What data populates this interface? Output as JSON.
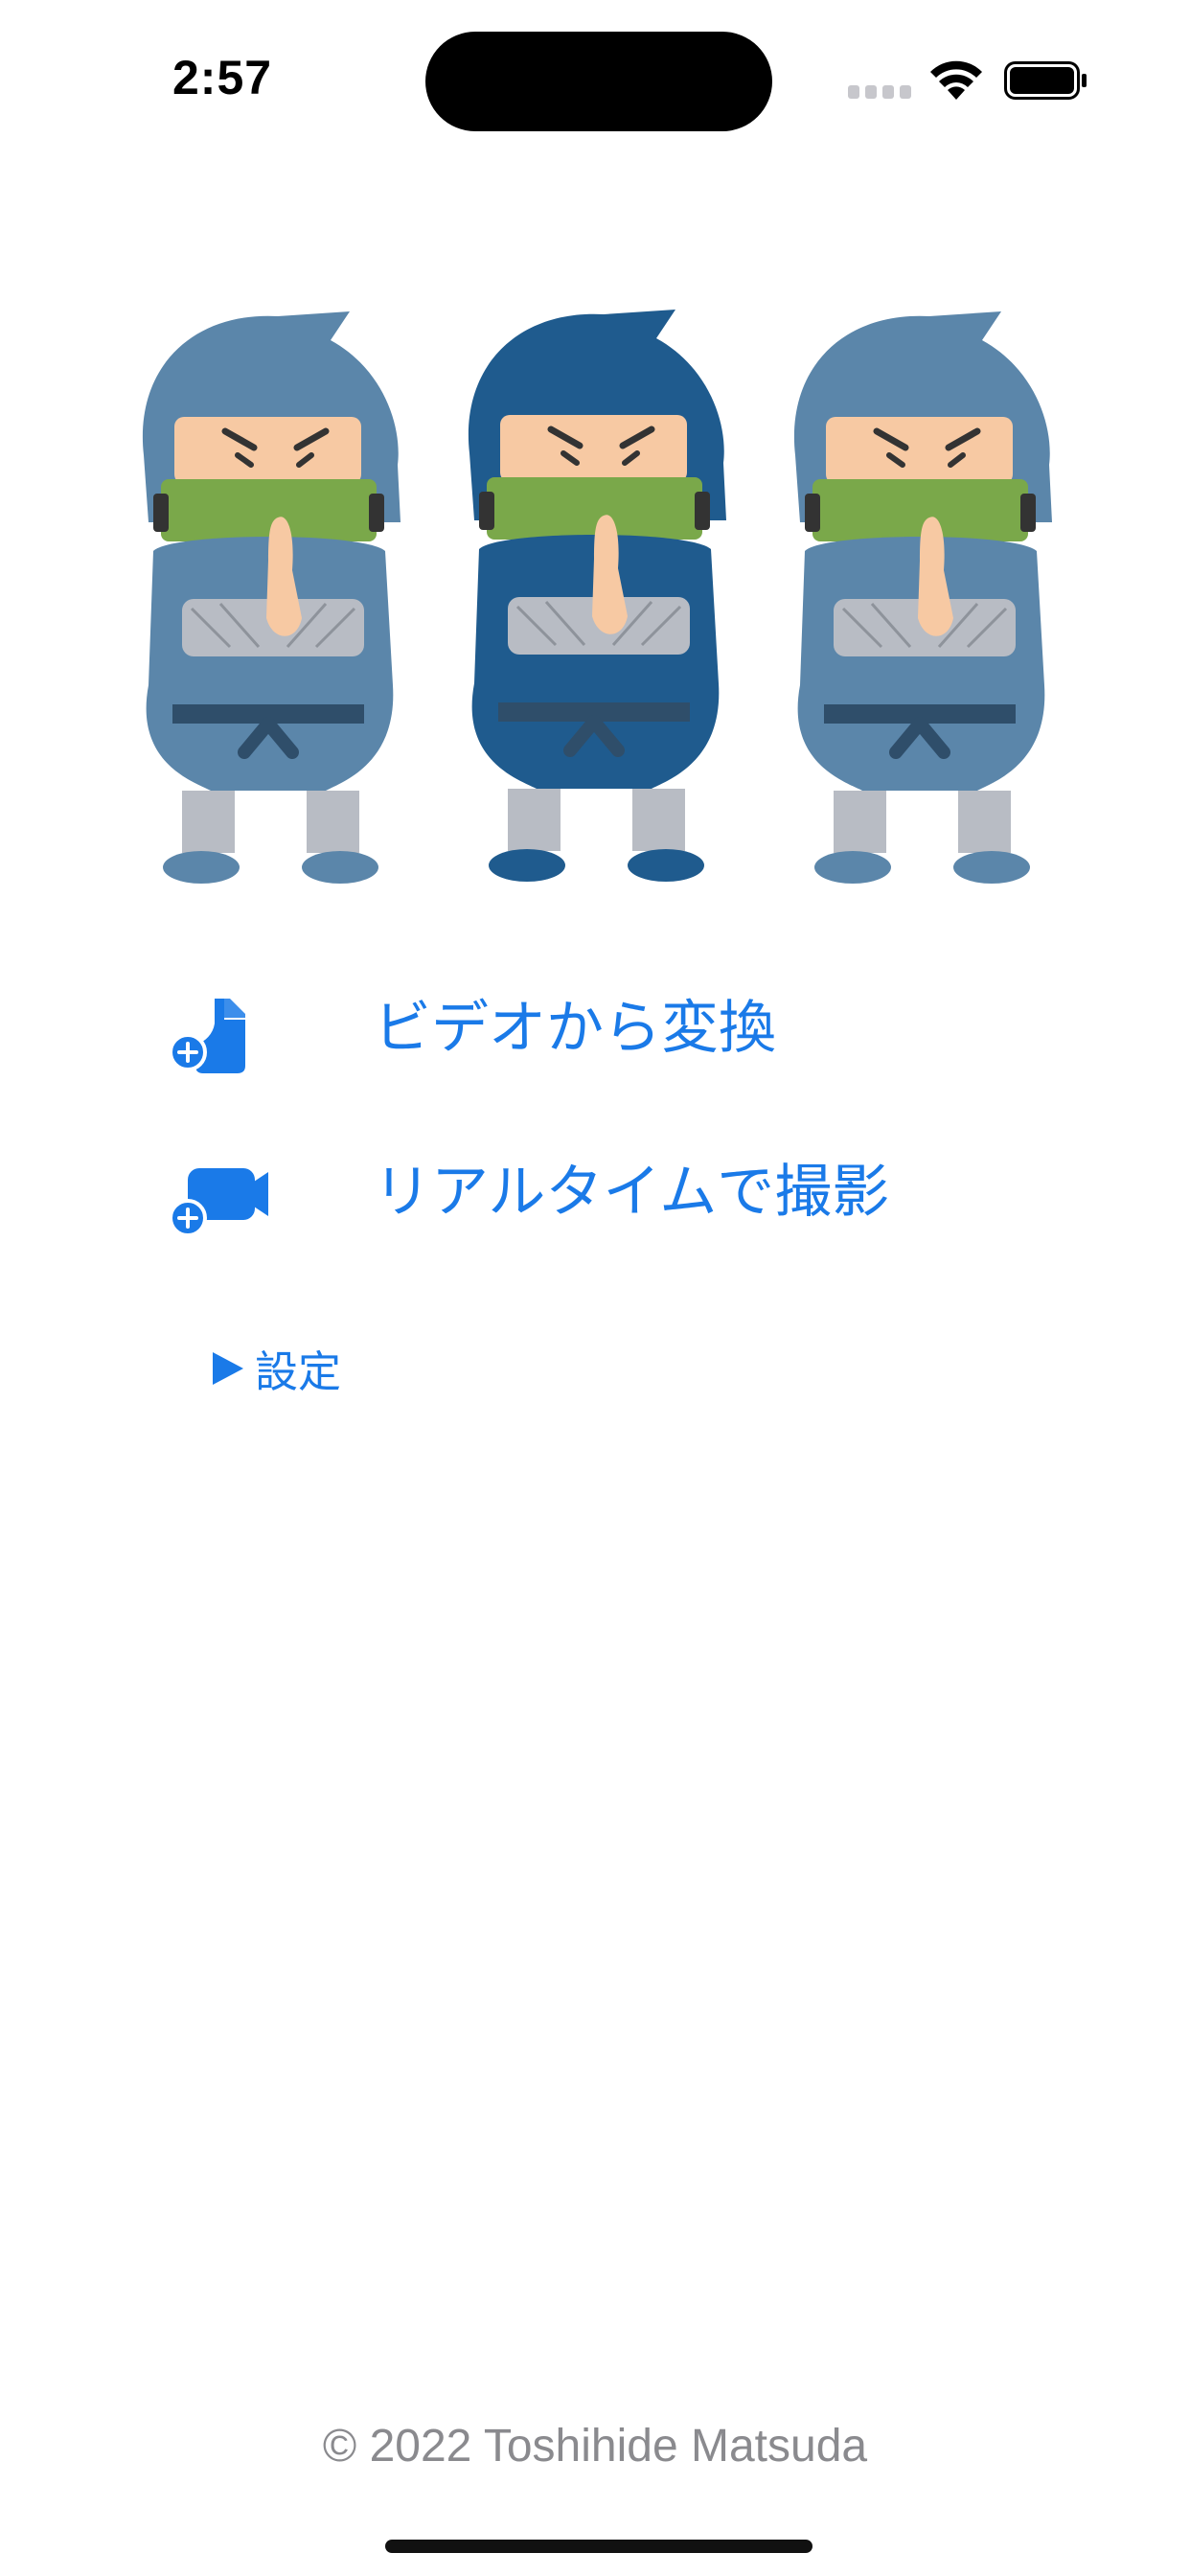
{
  "status_bar": {
    "time": "2:57"
  },
  "hero": {
    "icon": "ninja-illustration"
  },
  "menu": {
    "video_label": "ビデオから変換",
    "video_icon": "doc-plus-icon",
    "realtime_label": "リアルタイムで撮影",
    "realtime_icon": "video-plus-icon",
    "settings_label": "設定",
    "settings_icon": "disclosure-triangle-icon"
  },
  "footer": {
    "copyright": "© 2022 Toshihide Matsuda"
  },
  "colors": {
    "accent": "#1a7ae8",
    "muted_text": "#8a8a8e",
    "background": "#ffffff"
  }
}
